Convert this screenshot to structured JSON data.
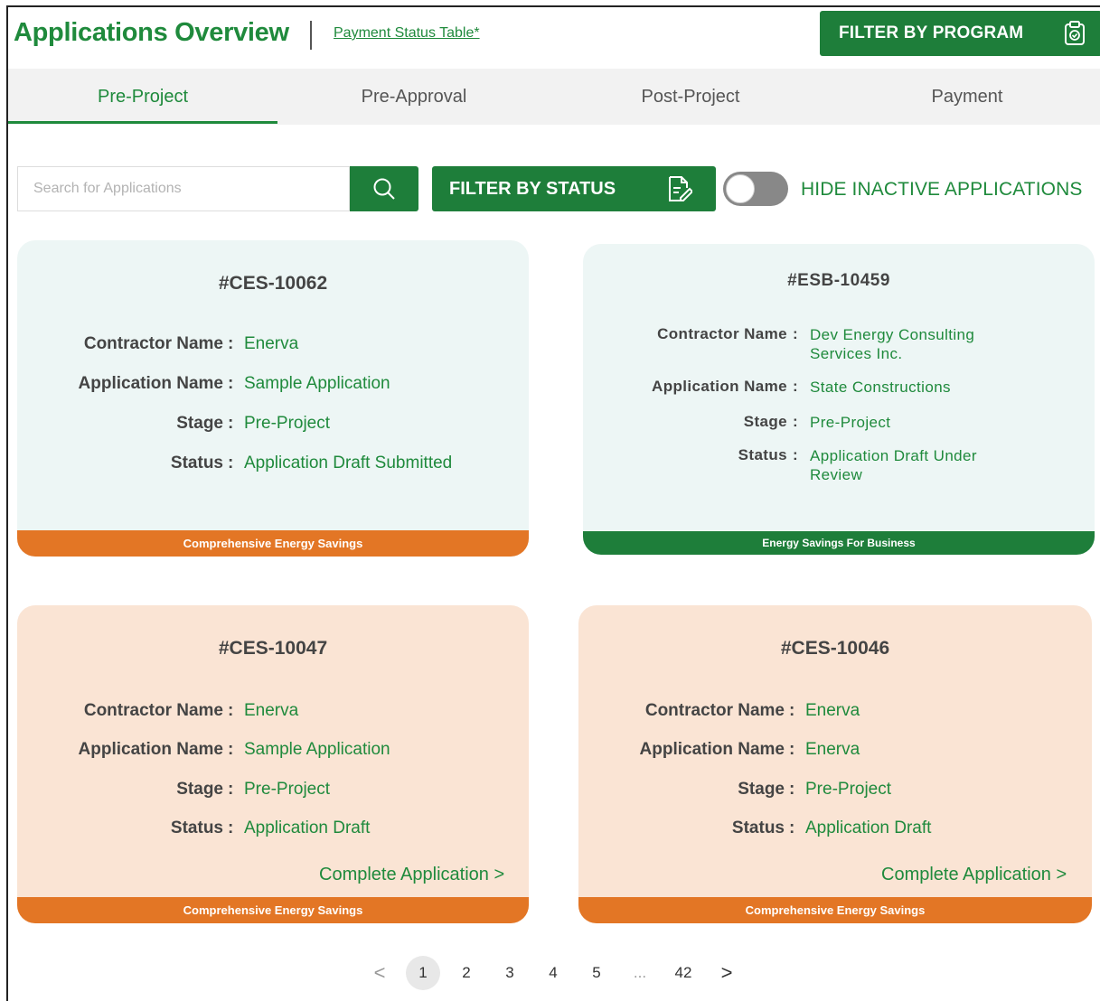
{
  "header": {
    "title": "Applications Overview",
    "payment_link": "Payment Status Table*",
    "filter_program_label": "FILTER BY PROGRAM"
  },
  "tabs": [
    {
      "label": "Pre-Project",
      "active": true
    },
    {
      "label": "Pre-Approval",
      "active": false
    },
    {
      "label": "Post-Project",
      "active": false
    },
    {
      "label": "Payment",
      "active": false
    }
  ],
  "toolbar": {
    "search_placeholder": "Search for Applications",
    "filter_status_label": "FILTER BY STATUS",
    "toggle_label": "HIDE INACTIVE APPLICATIONS",
    "toggle_on": false
  },
  "labels": {
    "contractor": "Contractor Name",
    "application": "Application Name",
    "stage": "Stage",
    "status": "Status",
    "colon": ":"
  },
  "cards": [
    {
      "id": "#CES-10062",
      "contractor": "Enerva",
      "application": "Sample Application",
      "stage": "Pre-Project",
      "status": "Application Draft Submitted",
      "program": "Comprehensive Energy Savings",
      "complete_link": ""
    },
    {
      "id": "#ESB-10459",
      "contractor": "Dev Energy Consulting Services Inc.",
      "application": "State Constructions",
      "stage": "Pre-Project",
      "status": "Application Draft Under Review",
      "program": "Energy Savings For Business",
      "complete_link": ""
    },
    {
      "id": "#CES-10047",
      "contractor": "Enerva",
      "application": "Sample Application",
      "stage": "Pre-Project",
      "status": "Application Draft",
      "program": "Comprehensive Energy Savings",
      "complete_link": "Complete Application >"
    },
    {
      "id": "#CES-10046",
      "contractor": "Enerva",
      "application": "Enerva",
      "stage": "Pre-Project",
      "status": "Application Draft",
      "program": "Comprehensive Energy Savings",
      "complete_link": "Complete Application >"
    }
  ],
  "pagination": {
    "prev": "<",
    "pages": [
      "1",
      "2",
      "3",
      "4",
      "5",
      "...",
      "42"
    ],
    "current": "1",
    "next": ">"
  },
  "colors": {
    "brand_green": "#1f8a3c",
    "button_green": "#1e7e3a",
    "orange": "#e37625",
    "mint_card": "#edf6f5",
    "peach_card": "#fae4d4"
  }
}
